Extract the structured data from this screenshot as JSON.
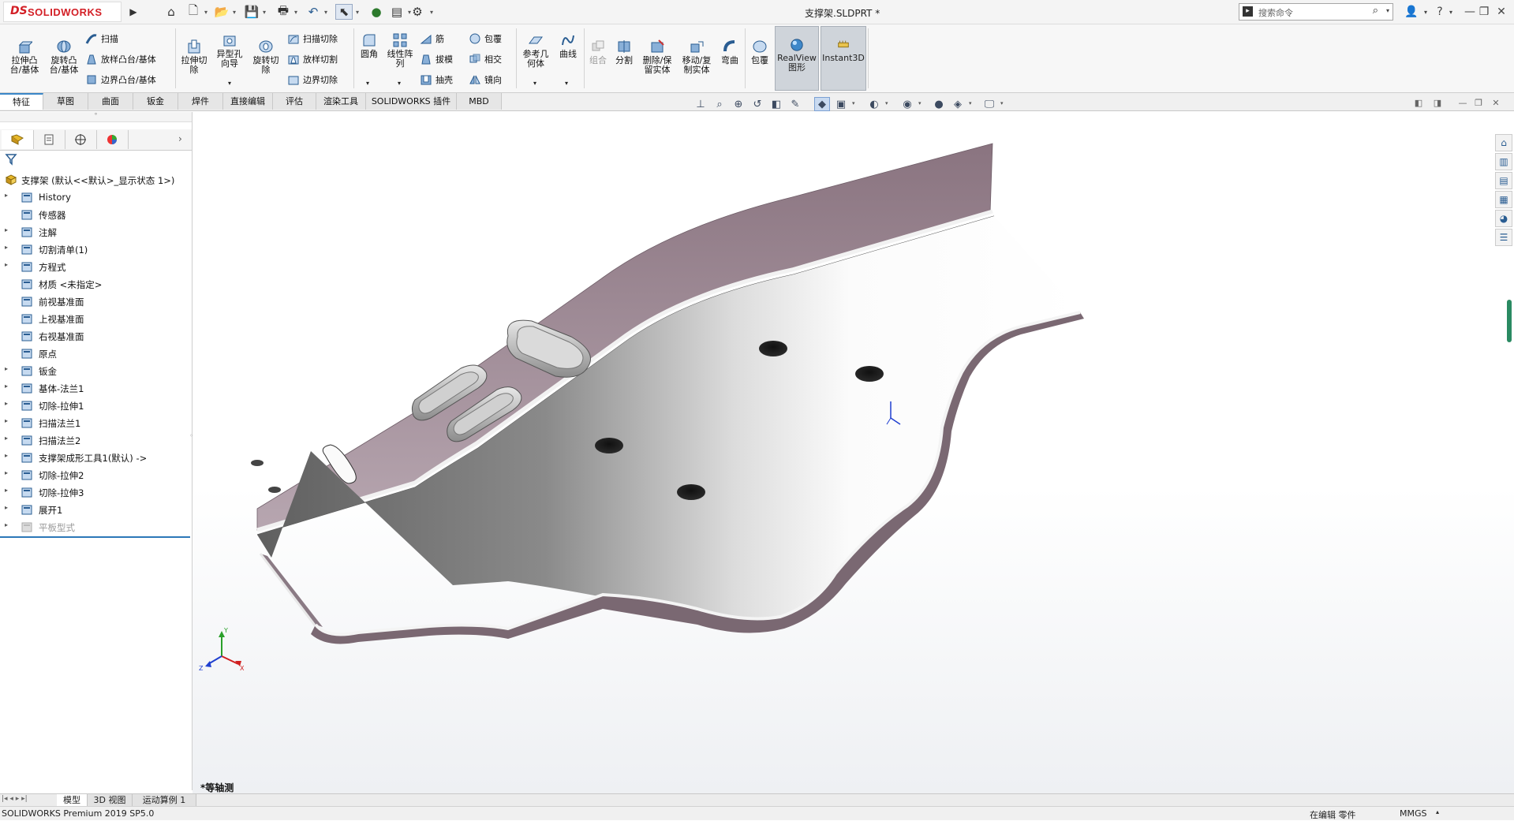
{
  "app": {
    "name": "SOLIDWORKS",
    "logo_prefix": "DS",
    "document_title": "支撑架.SLDPRT *",
    "search_placeholder": "搜索命令"
  },
  "ribbon": {
    "buttons": {
      "extrude_boss": "拉伸凸\n台/基体",
      "revolve_boss": "旋转凸\n台/基体",
      "sweep": "扫描",
      "loft": "放样凸台/基体",
      "boundary": "边界凸台/基体",
      "extrude_cut": "拉伸切\n除",
      "hole_wizard": "异型孔\n向导",
      "revolve_cut": "旋转切\n除",
      "sweep_cut": "扫描切除",
      "loft_cut": "放样切割",
      "boundary_cut": "边界切除",
      "fillet": "圆角",
      "linear_pattern": "线性阵\n列",
      "rib": "筋",
      "draft": "拔模",
      "shell": "抽壳",
      "wrap": "包覆",
      "intersect": "相交",
      "mirror": "镜向",
      "ref_geometry": "参考几\n何体",
      "curves": "曲线",
      "combine": "组合",
      "split": "分割",
      "delete_keep": "删除/保\n留实体",
      "move_copy": "移动/复\n制实体",
      "flex": "弯曲",
      "wrap2": "包覆",
      "realview": "RealView\n图形",
      "instant3d": "Instant3D"
    }
  },
  "tabs": [
    "特征",
    "草图",
    "曲面",
    "钣金",
    "焊件",
    "直接编辑",
    "评估",
    "渲染工具",
    "SOLIDWORKS 插件",
    "MBD"
  ],
  "active_tab": "特征",
  "tree": {
    "root": "支撑架  (默认<<默认>_显示状态 1>)",
    "items": [
      {
        "label": "History",
        "expandable": true
      },
      {
        "label": "传感器",
        "expandable": false
      },
      {
        "label": "注解",
        "expandable": true
      },
      {
        "label": "切割清单(1)",
        "expandable": true
      },
      {
        "label": "方程式",
        "expandable": true
      },
      {
        "label": "材质 <未指定>",
        "expandable": false
      },
      {
        "label": "前视基准面",
        "expandable": false
      },
      {
        "label": "上视基准面",
        "expandable": false
      },
      {
        "label": "右视基准面",
        "expandable": false
      },
      {
        "label": "原点",
        "expandable": false
      },
      {
        "label": "钣金",
        "expandable": true
      },
      {
        "label": "基体-法兰1",
        "expandable": true
      },
      {
        "label": "切除-拉伸1",
        "expandable": true
      },
      {
        "label": "扫描法兰1",
        "expandable": true
      },
      {
        "label": "扫描法兰2",
        "expandable": true
      },
      {
        "label": "支撑架成形工具1(默认) ->",
        "expandable": true
      },
      {
        "label": "切除-拉伸2",
        "expandable": true
      },
      {
        "label": "切除-拉伸3",
        "expandable": true
      },
      {
        "label": "展开1",
        "expandable": true
      },
      {
        "label": "平板型式",
        "expandable": true,
        "dimmed": true
      }
    ]
  },
  "viewport": {
    "view_label": "*等轴测",
    "triad": {
      "x": "X",
      "y": "Y",
      "z": "Z"
    }
  },
  "bottom_tabs": [
    "模型",
    "3D 视图",
    "运动算例 1"
  ],
  "active_bottom_tab": "模型",
  "status": {
    "version": "SOLIDWORKS Premium 2019 SP5.0",
    "mode": "在编辑 零件",
    "units": "MMGS"
  },
  "colors": {
    "accent": "#2c78b8",
    "brand": "#d31f26",
    "flange": "#9c8a96",
    "plate_dark": "#6a6a6a",
    "plate_light": "#f2f2f2"
  }
}
